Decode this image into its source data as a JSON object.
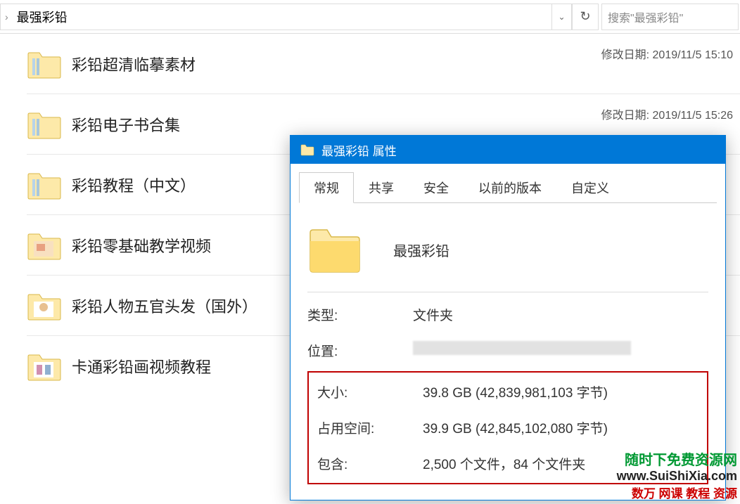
{
  "breadcrumb": {
    "current": "最强彩铅"
  },
  "search": {
    "placeholder": "搜索\"最强彩铅\""
  },
  "date_label": "修改日期:",
  "folders": [
    {
      "name": "彩铅超清临摹素材",
      "date": "2019/11/5 15:10"
    },
    {
      "name": "彩铅电子书合集",
      "date": "2019/11/5 15:26"
    },
    {
      "name": "彩铅教程（中文）",
      "date": ""
    },
    {
      "name": "彩铅零基础教学视频",
      "date": ""
    },
    {
      "name": "彩铅人物五官头发（国外）",
      "date": ""
    },
    {
      "name": "卡通彩铅画视频教程",
      "date": ""
    }
  ],
  "dialog": {
    "title": "最强彩铅 属性",
    "folder_name": "最强彩铅",
    "tabs": [
      "常规",
      "共享",
      "安全",
      "以前的版本",
      "自定义"
    ],
    "rows": {
      "type_label": "类型:",
      "type_value": "文件夹",
      "location_label": "位置:",
      "size_label": "大小:",
      "size_value": "39.8 GB (42,839,981,103 字节)",
      "disk_label": "占用空间:",
      "disk_value": "39.9 GB (42,845,102,080 字节)",
      "contains_label": "包含:",
      "contains_value": "2,500 个文件，84 个文件夹"
    }
  },
  "watermark": {
    "line1": "随时下免费资源网",
    "line2": "www.SuiShiXia.com",
    "line3": "数万 网课 教程 资源"
  }
}
